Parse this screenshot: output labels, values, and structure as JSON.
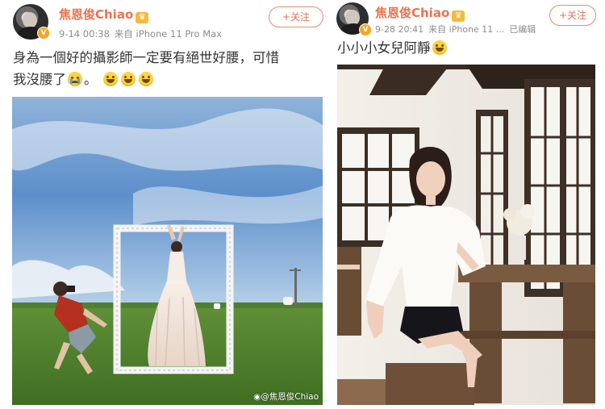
{
  "posts": [
    {
      "username": "焦恩俊Chiao",
      "date": "9-14 00:38",
      "source": "来自 iPhone 11 Pro Max",
      "follow_label": "+关注",
      "text_line1": "身為一個好的攝影師一定要有絕世好腰，可惜",
      "text_line2": "我沒腰了",
      "text_line2_end": "。",
      "watermark": "@焦恩俊Chiao"
    },
    {
      "username": "焦恩俊Chiao",
      "date": "9-28 20:41",
      "source": "来自 iPhone 11 ...",
      "edited": "已编辑",
      "follow_label": "+关注",
      "text": "小小小女兒阿靜"
    }
  ],
  "icons": [
    "avatar",
    "vip-badge-icon",
    "crown-icon",
    "crying-emoji-icon",
    "grin-emoji-icon",
    "weibo-logo-icon"
  ],
  "colors": {
    "username": "#eb7350",
    "meta": "#8d8d8d",
    "text": "#333333",
    "follow_border": "#f08a6a"
  }
}
